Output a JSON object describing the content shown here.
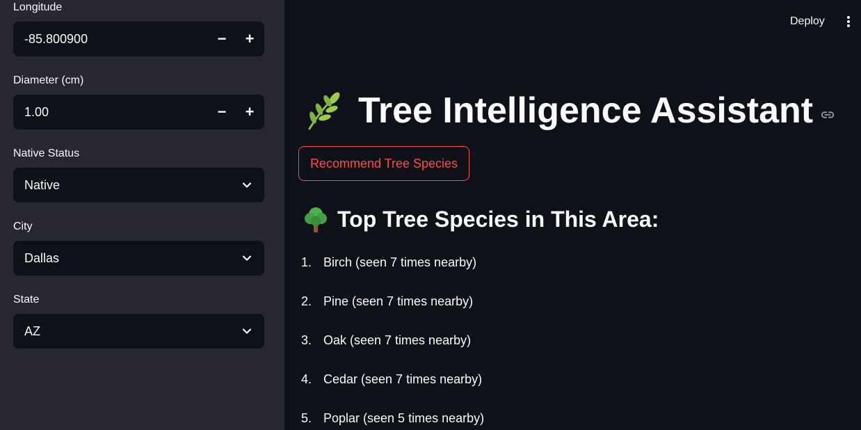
{
  "sidebar": {
    "longitude": {
      "label": "Longitude",
      "value": "-85.800900",
      "minus": "−",
      "plus": "+"
    },
    "diameter": {
      "label": "Diameter (cm)",
      "value": "1.00",
      "minus": "−",
      "plus": "+"
    },
    "native_status": {
      "label": "Native Status",
      "value": "Native"
    },
    "city": {
      "label": "City",
      "value": "Dallas"
    },
    "state": {
      "label": "State",
      "value": "AZ"
    }
  },
  "header": {
    "deploy_label": "Deploy",
    "menu_icon": "kebab-menu-icon"
  },
  "main": {
    "title": "Tree Intelligence Assistant",
    "title_icon": "herb-icon",
    "recommend_button": "Recommend Tree Species",
    "subheader": "Top Tree Species in This Area:",
    "subheader_icon": "tree-icon",
    "species": [
      {
        "num": "1.",
        "text": "Birch (seen 7 times nearby)"
      },
      {
        "num": "2.",
        "text": "Pine (seen 7 times nearby)"
      },
      {
        "num": "3.",
        "text": "Oak (seen 7 times nearby)"
      },
      {
        "num": "4.",
        "text": "Cedar (seen 7 times nearby)"
      },
      {
        "num": "5.",
        "text": "Poplar (seen 5 times nearby)"
      }
    ]
  },
  "colors": {
    "sidebar_bg": "#262730",
    "main_bg": "#0e1117",
    "accent": "#ff4b4b",
    "text": "#fafafa"
  }
}
